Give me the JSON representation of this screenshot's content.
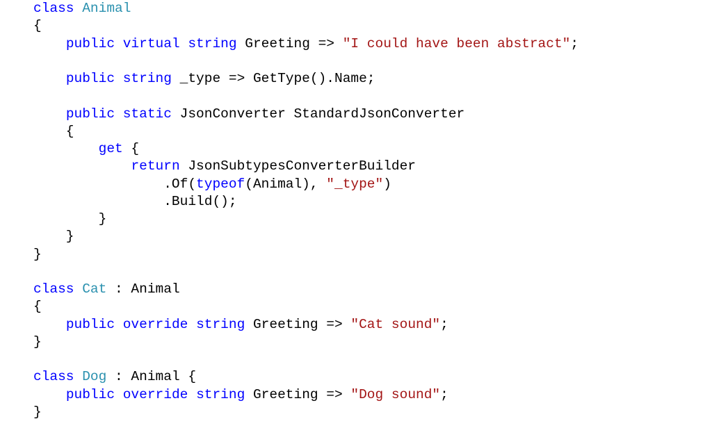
{
  "editor": {
    "language": "C#",
    "colors": {
      "keyword": "#0000ff",
      "type": "#2b91af",
      "string": "#a31515",
      "plain": "#000000",
      "background": "#ffffff"
    },
    "lines": [
      [
        {
          "t": "kw",
          "v": "class"
        },
        {
          "t": "pl",
          "v": " "
        },
        {
          "t": "ty",
          "v": "Animal"
        }
      ],
      [
        {
          "t": "pl",
          "v": "{"
        }
      ],
      [
        {
          "t": "pl",
          "v": "    "
        },
        {
          "t": "kw",
          "v": "public"
        },
        {
          "t": "pl",
          "v": " "
        },
        {
          "t": "kw",
          "v": "virtual"
        },
        {
          "t": "pl",
          "v": " "
        },
        {
          "t": "kw",
          "v": "string"
        },
        {
          "t": "pl",
          "v": " Greeting => "
        },
        {
          "t": "st",
          "v": "\"I could have been abstract\""
        },
        {
          "t": "pl",
          "v": ";"
        }
      ],
      [],
      [
        {
          "t": "pl",
          "v": "    "
        },
        {
          "t": "kw",
          "v": "public"
        },
        {
          "t": "pl",
          "v": " "
        },
        {
          "t": "kw",
          "v": "string"
        },
        {
          "t": "pl",
          "v": " _type => GetType().Name;"
        }
      ],
      [],
      [
        {
          "t": "pl",
          "v": "    "
        },
        {
          "t": "kw",
          "v": "public"
        },
        {
          "t": "pl",
          "v": " "
        },
        {
          "t": "kw",
          "v": "static"
        },
        {
          "t": "pl",
          "v": " JsonConverter StandardJsonConverter"
        }
      ],
      [
        {
          "t": "pl",
          "v": "    {"
        }
      ],
      [
        {
          "t": "pl",
          "v": "        "
        },
        {
          "t": "kw",
          "v": "get"
        },
        {
          "t": "pl",
          "v": " {"
        }
      ],
      [
        {
          "t": "pl",
          "v": "            "
        },
        {
          "t": "kw",
          "v": "return"
        },
        {
          "t": "pl",
          "v": " JsonSubtypesConverterBuilder"
        }
      ],
      [
        {
          "t": "pl",
          "v": "                .Of("
        },
        {
          "t": "kw",
          "v": "typeof"
        },
        {
          "t": "pl",
          "v": "(Animal), "
        },
        {
          "t": "st",
          "v": "\"_type\""
        },
        {
          "t": "pl",
          "v": ")"
        }
      ],
      [
        {
          "t": "pl",
          "v": "                .Build();"
        }
      ],
      [
        {
          "t": "pl",
          "v": "        }"
        }
      ],
      [
        {
          "t": "pl",
          "v": "    }"
        }
      ],
      [
        {
          "t": "pl",
          "v": "}"
        }
      ],
      [],
      [
        {
          "t": "kw",
          "v": "class"
        },
        {
          "t": "pl",
          "v": " "
        },
        {
          "t": "ty",
          "v": "Cat"
        },
        {
          "t": "pl",
          "v": " : Animal"
        }
      ],
      [
        {
          "t": "pl",
          "v": "{"
        }
      ],
      [
        {
          "t": "pl",
          "v": "    "
        },
        {
          "t": "kw",
          "v": "public"
        },
        {
          "t": "pl",
          "v": " "
        },
        {
          "t": "kw",
          "v": "override"
        },
        {
          "t": "pl",
          "v": " "
        },
        {
          "t": "kw",
          "v": "string"
        },
        {
          "t": "pl",
          "v": " Greeting => "
        },
        {
          "t": "st",
          "v": "\"Cat sound\""
        },
        {
          "t": "pl",
          "v": ";"
        }
      ],
      [
        {
          "t": "pl",
          "v": "}"
        }
      ],
      [],
      [
        {
          "t": "kw",
          "v": "class"
        },
        {
          "t": "pl",
          "v": " "
        },
        {
          "t": "ty",
          "v": "Dog"
        },
        {
          "t": "pl",
          "v": " : Animal {"
        }
      ],
      [
        {
          "t": "pl",
          "v": "    "
        },
        {
          "t": "kw",
          "v": "public"
        },
        {
          "t": "pl",
          "v": " "
        },
        {
          "t": "kw",
          "v": "override"
        },
        {
          "t": "pl",
          "v": " "
        },
        {
          "t": "kw",
          "v": "string"
        },
        {
          "t": "pl",
          "v": " Greeting => "
        },
        {
          "t": "st",
          "v": "\"Dog sound\""
        },
        {
          "t": "pl",
          "v": ";"
        }
      ],
      [
        {
          "t": "pl",
          "v": "}"
        }
      ]
    ]
  }
}
